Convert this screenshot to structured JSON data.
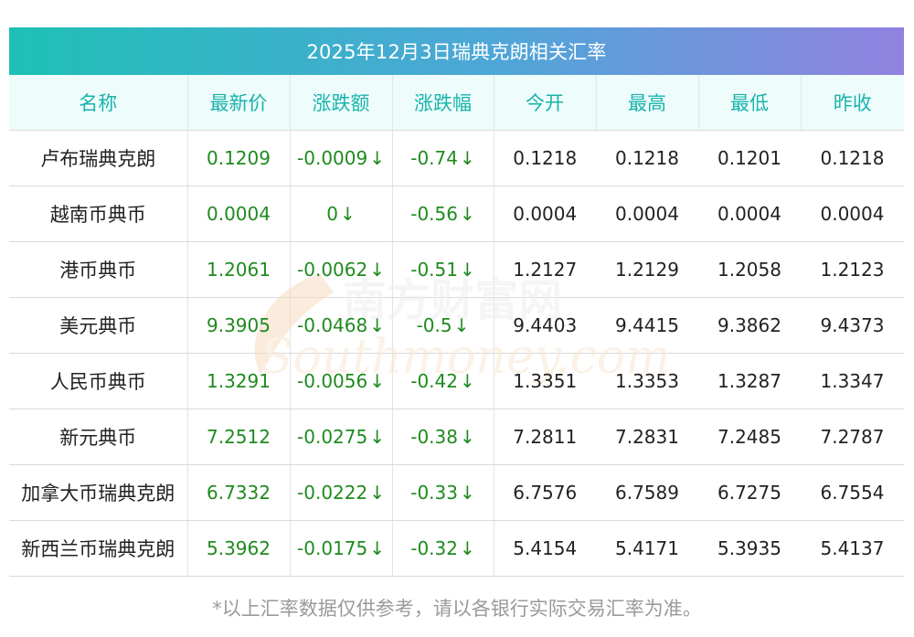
{
  "title": "2025年12月3日瑞典克朗相关汇率",
  "headers": [
    "名称",
    "最新价",
    "涨跌额",
    "涨跌幅",
    "今开",
    "最高",
    "最低",
    "昨收"
  ],
  "rows": [
    {
      "name": "卢布瑞典克朗",
      "latest": "0.1209",
      "change": "-0.0009",
      "pct": "-0.74",
      "open": "0.1218",
      "high": "0.1218",
      "low": "0.1201",
      "prev": "0.1218"
    },
    {
      "name": "越南币典币",
      "latest": "0.0004",
      "change": "0",
      "pct": "-0.56",
      "open": "0.0004",
      "high": "0.0004",
      "low": "0.0004",
      "prev": "0.0004"
    },
    {
      "name": "港币典币",
      "latest": "1.2061",
      "change": "-0.0062",
      "pct": "-0.51",
      "open": "1.2127",
      "high": "1.2129",
      "low": "1.2058",
      "prev": "1.2123"
    },
    {
      "name": "美元典币",
      "latest": "9.3905",
      "change": "-0.0468",
      "pct": "-0.5",
      "open": "9.4403",
      "high": "9.4415",
      "low": "9.3862",
      "prev": "9.4373"
    },
    {
      "name": "人民币典币",
      "latest": "1.3291",
      "change": "-0.0056",
      "pct": "-0.42",
      "open": "1.3351",
      "high": "1.3353",
      "low": "1.3287",
      "prev": "1.3347"
    },
    {
      "name": "新元典币",
      "latest": "7.2512",
      "change": "-0.0275",
      "pct": "-0.38",
      "open": "7.2811",
      "high": "7.2831",
      "low": "7.2485",
      "prev": "7.2787"
    },
    {
      "name": "加拿大币瑞典克朗",
      "latest": "6.7332",
      "change": "-0.0222",
      "pct": "-0.33",
      "open": "6.7576",
      "high": "6.7589",
      "low": "6.7275",
      "prev": "6.7554"
    },
    {
      "name": "新西兰币瑞典克朗",
      "latest": "5.3962",
      "change": "-0.0175",
      "pct": "-0.32",
      "open": "5.4154",
      "high": "5.4171",
      "low": "5.3935",
      "prev": "5.4137"
    }
  ],
  "arrow_symbol": "↓",
  "watermark": {
    "cn": "南方财富网",
    "en": "Southmoney.com"
  },
  "footer": "*以上汇率数据仅供参考，请以各银行实际交易汇率为准。",
  "colors": {
    "header_text": "#19b3ac",
    "positive_green": "#1f8a1f",
    "title_gradient_start": "#1ec0b6",
    "title_gradient_end": "#9182e0"
  }
}
